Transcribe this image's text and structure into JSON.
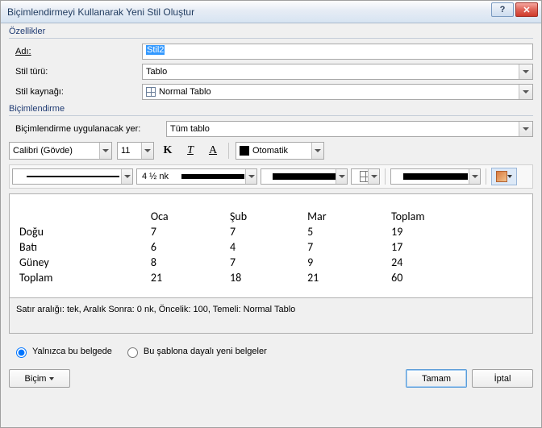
{
  "window": {
    "title": "Biçimlendirmeyi Kullanarak Yeni Stil Oluştur"
  },
  "sections": {
    "properties_label": "Özellikler",
    "formatting_label": "Biçimlendirme"
  },
  "fields": {
    "name_label": "Adı:",
    "name_value": "Stil2",
    "style_type_label": "Stil türü:",
    "style_type_value": "Tablo",
    "style_based_label": "Stil kaynağı:",
    "style_based_value": "Normal Tablo",
    "apply_to_label": "Biçimlendirme uygulanacak yer:",
    "apply_to_value": "Tüm tablo"
  },
  "format_toolbar": {
    "font": "Calibri (Gövde)",
    "size": "11",
    "auto_color_label": "Otomatik",
    "weight": "4 ½ nk"
  },
  "chart_data": {
    "type": "table",
    "columns": [
      "",
      "Oca",
      "Şub",
      "Mar",
      "Toplam"
    ],
    "rows": [
      {
        "label": "Doğu",
        "values": [
          "7",
          "7",
          "5",
          "19"
        ]
      },
      {
        "label": "Batı",
        "values": [
          "6",
          "4",
          "7",
          "17"
        ]
      },
      {
        "label": "Güney",
        "values": [
          "8",
          "7",
          "9",
          "24"
        ]
      },
      {
        "label": "Toplam",
        "values": [
          "21",
          "18",
          "21",
          "60"
        ]
      }
    ]
  },
  "status": "Satır aralığı:  tek, Aralık Sonra:  0 nk, Öncelik: 100, Temeli: Normal Tablo",
  "radio": {
    "only_doc": "Yalnızca bu belgede",
    "template_docs": "Bu şablona dayalı yeni belgeler"
  },
  "buttons": {
    "format": "Biçim",
    "ok": "Tamam",
    "cancel": "İptal"
  }
}
